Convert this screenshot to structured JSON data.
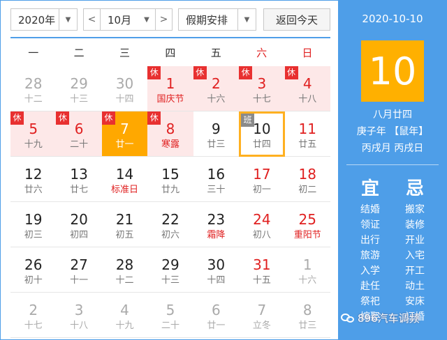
{
  "toolbar": {
    "year": "2020年",
    "month": "10月",
    "holiday": "假期安排",
    "today_label": "返回今天",
    "prev_glyph": "<",
    "next_glyph": ">",
    "dropdown_glyph": "▼"
  },
  "weekdays": [
    "一",
    "二",
    "三",
    "四",
    "五",
    "六",
    "日"
  ],
  "tags": {
    "rest": "休",
    "work": "班"
  },
  "days": [
    {
      "n": "28",
      "l": "十二",
      "out": true
    },
    {
      "n": "29",
      "l": "十三",
      "out": true
    },
    {
      "n": "30",
      "l": "十四",
      "out": true
    },
    {
      "n": "1",
      "l": "国庆节",
      "hol": true,
      "tag": "rest",
      "fest": true
    },
    {
      "n": "2",
      "l": "十六",
      "hol": true,
      "tag": "rest"
    },
    {
      "n": "3",
      "l": "十七",
      "hol": true,
      "tag": "rest"
    },
    {
      "n": "4",
      "l": "十八",
      "hol": true,
      "tag": "rest"
    },
    {
      "n": "5",
      "l": "十九",
      "hol": true,
      "tag": "rest"
    },
    {
      "n": "6",
      "l": "二十",
      "hol": true,
      "tag": "rest"
    },
    {
      "n": "7",
      "l": "廿一",
      "tag": "rest",
      "selected": true
    },
    {
      "n": "8",
      "l": "寒露",
      "hol": true,
      "tag": "rest",
      "fest": true
    },
    {
      "n": "9",
      "l": "廿三"
    },
    {
      "n": "10",
      "l": "廿四",
      "tag": "work",
      "today": true
    },
    {
      "n": "11",
      "l": "廿五"
    },
    {
      "n": "12",
      "l": "廿六"
    },
    {
      "n": "13",
      "l": "廿七"
    },
    {
      "n": "14",
      "l": "标准日",
      "fest": true
    },
    {
      "n": "15",
      "l": "廿九"
    },
    {
      "n": "16",
      "l": "三十"
    },
    {
      "n": "17",
      "l": "初一"
    },
    {
      "n": "18",
      "l": "初二"
    },
    {
      "n": "19",
      "l": "初三"
    },
    {
      "n": "20",
      "l": "初四"
    },
    {
      "n": "21",
      "l": "初五"
    },
    {
      "n": "22",
      "l": "初六"
    },
    {
      "n": "23",
      "l": "霜降",
      "fest": true
    },
    {
      "n": "24",
      "l": "初八"
    },
    {
      "n": "25",
      "l": "重阳节",
      "fest": true
    },
    {
      "n": "26",
      "l": "初十"
    },
    {
      "n": "27",
      "l": "十一"
    },
    {
      "n": "28",
      "l": "十二"
    },
    {
      "n": "29",
      "l": "十三"
    },
    {
      "n": "30",
      "l": "十四"
    },
    {
      "n": "31",
      "l": "十五"
    },
    {
      "n": "1",
      "l": "十六",
      "out": true
    },
    {
      "n": "2",
      "l": "十七",
      "out": true
    },
    {
      "n": "3",
      "l": "十八",
      "out": true
    },
    {
      "n": "4",
      "l": "十九",
      "out": true
    },
    {
      "n": "5",
      "l": "二十",
      "out": true
    },
    {
      "n": "6",
      "l": "廿一",
      "out": true
    },
    {
      "n": "7",
      "l": "立冬",
      "out": true
    },
    {
      "n": "8",
      "l": "廿三",
      "out": true
    }
  ],
  "panel": {
    "date": "2020-10-10",
    "big_day": "10",
    "lunar": "八月廿四",
    "year_line": "庚子年 【鼠年】",
    "ganzhi": "丙戌月 丙戌日",
    "yi_title": "宜",
    "ji_title": "忌",
    "yi": [
      "结婚",
      "领证",
      "出行",
      "旅游",
      "入学",
      "赴任",
      "祭祀",
      "嫁娶"
    ],
    "ji": [
      "搬家",
      "装修",
      "开业",
      "入宅",
      "开工",
      "动土",
      "安床",
      "订婚"
    ]
  },
  "watermark": "896汽车调频"
}
